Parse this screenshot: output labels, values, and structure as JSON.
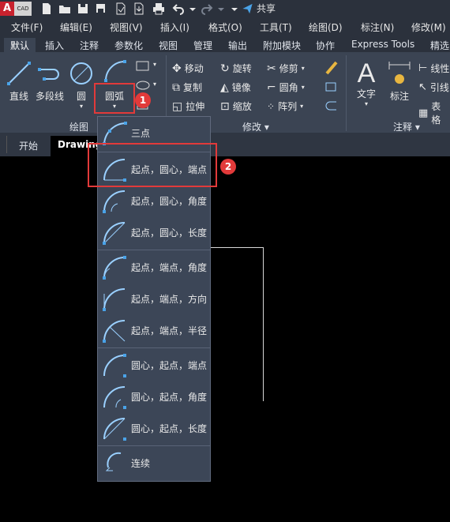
{
  "app": {
    "logo_letter": "A",
    "logo_sub": "CAD"
  },
  "qat": {
    "share_label": "共享"
  },
  "menu": [
    "文件(F)",
    "编辑(E)",
    "视图(V)",
    "插入(I)",
    "格式(O)",
    "工具(T)",
    "绘图(D)",
    "标注(N)",
    "修改(M)"
  ],
  "ribbon_tabs": [
    "默认",
    "插入",
    "注释",
    "参数化",
    "视图",
    "管理",
    "输出",
    "附加模块",
    "协作",
    "Express Tools",
    "精选"
  ],
  "draw_panel": {
    "title": "绘图",
    "line": "直线",
    "polyline": "多段线",
    "circle": "圆",
    "arc": "圆弧"
  },
  "modify_panel": {
    "title": "修改",
    "move": "移动",
    "rotate": "旋转",
    "trim": "修剪",
    "copy": "复制",
    "mirror": "镜像",
    "fillet": "圆角",
    "stretch": "拉伸",
    "scale": "缩放",
    "array": "阵列"
  },
  "annotation_panel": {
    "title": "注释",
    "text": "文字",
    "dimension": "标注",
    "linear": "线性",
    "leader": "引线",
    "table": "表格"
  },
  "doc_tabs": [
    "开始",
    "Drawing"
  ],
  "arc_menu": [
    "三点",
    "起点，圆心，端点",
    "起点，圆心，角度",
    "起点，圆心，长度",
    "起点，端点，角度",
    "起点，端点，方向",
    "起点，端点，半径",
    "圆心，起点，端点",
    "圆心，起点，角度",
    "圆心，起点，长度",
    "连续"
  ],
  "badges": [
    "1",
    "2"
  ],
  "colors": {
    "accent_red": "#e23a3a",
    "ribbon_bg": "#3b4453",
    "menu_bg": "#2b313c"
  }
}
